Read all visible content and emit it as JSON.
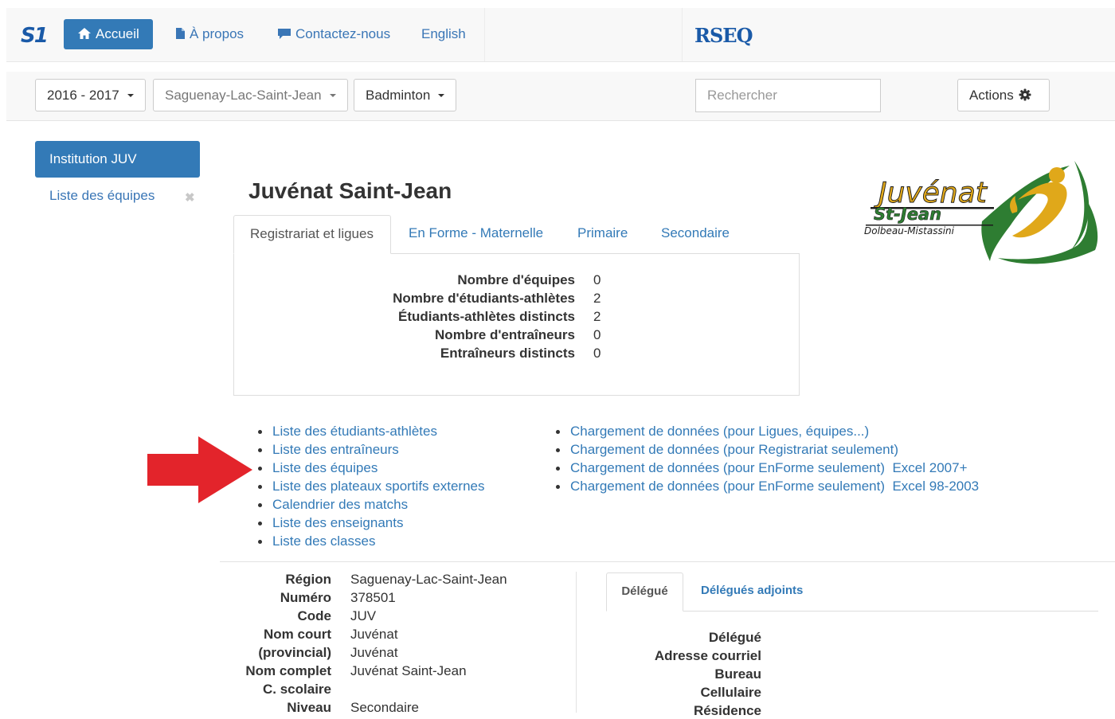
{
  "nav": {
    "brand": "S1",
    "items": [
      {
        "label": "Accueil",
        "icon": "home-icon",
        "active": true
      },
      {
        "label": "À propos",
        "icon": "file-icon"
      },
      {
        "label": "Contactez-nous",
        "icon": "comment-icon"
      },
      {
        "label": "English"
      }
    ],
    "rseq": "RSEQ"
  },
  "toolbar": {
    "season": "2016 - 2017",
    "region": "Saguenay-Lac-Saint-Jean",
    "sport": "Badminton",
    "search_placeholder": "Rechercher",
    "actions_label": "Actions"
  },
  "sidebar": {
    "active_label": "Institution JUV",
    "link_label": "Liste des équipes"
  },
  "page": {
    "title": "Juvénat Saint-Jean",
    "logo": {
      "line1": "Juvénat",
      "line2": "St-Jean",
      "line3": "Dolbeau-Mistassini"
    }
  },
  "tabs": [
    "Registrariat et ligues",
    "En Forme - Maternelle",
    "Primaire",
    "Secondaire"
  ],
  "stats": [
    {
      "label": "Nombre d'équipes",
      "value": "0"
    },
    {
      "label": "Nombre d'étudiants-athlètes",
      "value": "2"
    },
    {
      "label": "Étudiants-athlètes distincts",
      "value": "2"
    },
    {
      "label": "Nombre d'entraîneurs",
      "value": "0"
    },
    {
      "label": "Entraîneurs distincts",
      "value": "0"
    }
  ],
  "links_left": [
    "Liste des étudiants-athlètes",
    "Liste des entraîneurs",
    "Liste des équipes",
    "Liste des plateaux sportifs externes",
    "Calendrier des matchs",
    "Liste des enseignants",
    "Liste des classes"
  ],
  "links_right": [
    {
      "text": "Chargement de données (pour Ligues, équipes...)",
      "extra": ""
    },
    {
      "text": "Chargement de données (pour Registrariat seulement)",
      "extra": ""
    },
    {
      "text": "Chargement de données (pour EnForme seulement)",
      "extra": "Excel 2007+"
    },
    {
      "text": "Chargement de données (pour EnForme seulement)",
      "extra": "Excel 98-2003"
    }
  ],
  "info": [
    {
      "label": "Région",
      "value": "Saguenay-Lac-Saint-Jean"
    },
    {
      "label": "Numéro",
      "value": "378501"
    },
    {
      "label": "Code",
      "value": "JUV"
    },
    {
      "label": "Nom court",
      "value": "Juvénat"
    },
    {
      "label": "(provincial)",
      "value": "Juvénat"
    },
    {
      "label": "Nom complet",
      "value": "Juvénat Saint-Jean"
    },
    {
      "label": "C. scolaire",
      "value": ""
    },
    {
      "label": "Niveau",
      "value": "Secondaire"
    }
  ],
  "delegate_tabs": [
    "Délégué",
    "Délégués adjoints"
  ],
  "delegate_fields": [
    "Délégué",
    "Adresse courriel",
    "Bureau",
    "Cellulaire",
    "Résidence"
  ],
  "colors": {
    "primary": "#337ab7",
    "link": "#3a76b6",
    "arrow": "#e3242b",
    "logo_green": "#2e7d32",
    "logo_gold": "#e0a81a"
  }
}
